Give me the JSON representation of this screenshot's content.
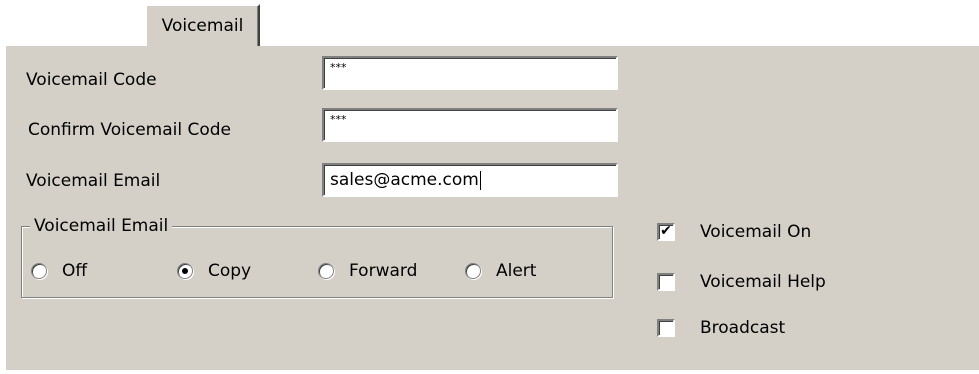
{
  "tab": {
    "label": "Voicemail"
  },
  "fields": {
    "voicemail_code": {
      "label": "Voicemail Code",
      "value": "***"
    },
    "confirm_code": {
      "label": "Confirm Voicemail Code",
      "value": "***"
    },
    "voicemail_email": {
      "label": "Voicemail Email",
      "value": "sales@acme.com"
    }
  },
  "email_mode": {
    "title": "Voicemail Email",
    "options": [
      "Off",
      "Copy",
      "Forward",
      "Alert"
    ],
    "selected": "Copy"
  },
  "checkboxes": {
    "voicemail_on": {
      "label": "Voicemail On",
      "checked": true,
      "mark": "✔"
    },
    "voicemail_help": {
      "label": "Voicemail Help",
      "checked": false
    },
    "broadcast": {
      "label": "Broadcast",
      "checked": false
    }
  }
}
